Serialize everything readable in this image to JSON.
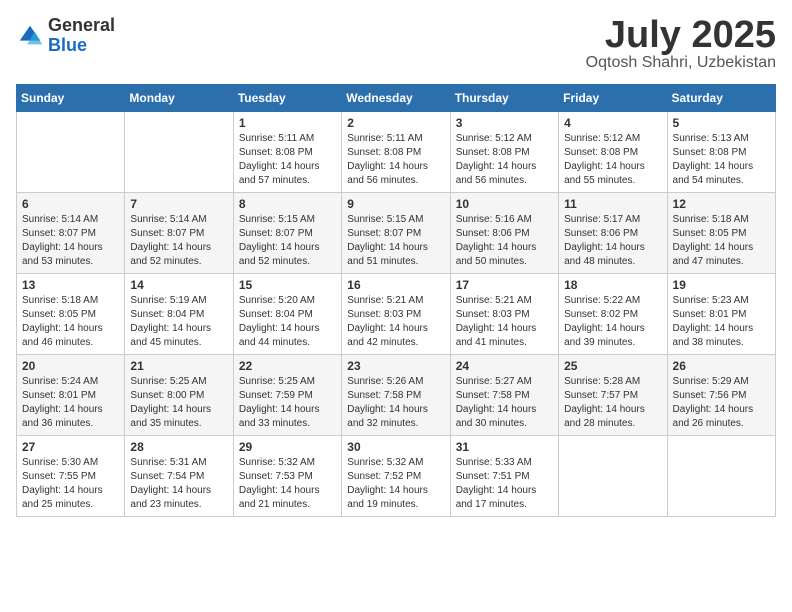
{
  "logo": {
    "general": "General",
    "blue": "Blue"
  },
  "title": "July 2025",
  "subtitle": "Oqtosh Shahri, Uzbekistan",
  "days_of_week": [
    "Sunday",
    "Monday",
    "Tuesday",
    "Wednesday",
    "Thursday",
    "Friday",
    "Saturday"
  ],
  "weeks": [
    [
      {
        "day": "",
        "content": ""
      },
      {
        "day": "",
        "content": ""
      },
      {
        "day": "1",
        "sunrise": "Sunrise: 5:11 AM",
        "sunset": "Sunset: 8:08 PM",
        "daylight": "Daylight: 14 hours and 57 minutes."
      },
      {
        "day": "2",
        "sunrise": "Sunrise: 5:11 AM",
        "sunset": "Sunset: 8:08 PM",
        "daylight": "Daylight: 14 hours and 56 minutes."
      },
      {
        "day": "3",
        "sunrise": "Sunrise: 5:12 AM",
        "sunset": "Sunset: 8:08 PM",
        "daylight": "Daylight: 14 hours and 56 minutes."
      },
      {
        "day": "4",
        "sunrise": "Sunrise: 5:12 AM",
        "sunset": "Sunset: 8:08 PM",
        "daylight": "Daylight: 14 hours and 55 minutes."
      },
      {
        "day": "5",
        "sunrise": "Sunrise: 5:13 AM",
        "sunset": "Sunset: 8:08 PM",
        "daylight": "Daylight: 14 hours and 54 minutes."
      }
    ],
    [
      {
        "day": "6",
        "sunrise": "Sunrise: 5:14 AM",
        "sunset": "Sunset: 8:07 PM",
        "daylight": "Daylight: 14 hours and 53 minutes."
      },
      {
        "day": "7",
        "sunrise": "Sunrise: 5:14 AM",
        "sunset": "Sunset: 8:07 PM",
        "daylight": "Daylight: 14 hours and 52 minutes."
      },
      {
        "day": "8",
        "sunrise": "Sunrise: 5:15 AM",
        "sunset": "Sunset: 8:07 PM",
        "daylight": "Daylight: 14 hours and 52 minutes."
      },
      {
        "day": "9",
        "sunrise": "Sunrise: 5:15 AM",
        "sunset": "Sunset: 8:07 PM",
        "daylight": "Daylight: 14 hours and 51 minutes."
      },
      {
        "day": "10",
        "sunrise": "Sunrise: 5:16 AM",
        "sunset": "Sunset: 8:06 PM",
        "daylight": "Daylight: 14 hours and 50 minutes."
      },
      {
        "day": "11",
        "sunrise": "Sunrise: 5:17 AM",
        "sunset": "Sunset: 8:06 PM",
        "daylight": "Daylight: 14 hours and 48 minutes."
      },
      {
        "day": "12",
        "sunrise": "Sunrise: 5:18 AM",
        "sunset": "Sunset: 8:05 PM",
        "daylight": "Daylight: 14 hours and 47 minutes."
      }
    ],
    [
      {
        "day": "13",
        "sunrise": "Sunrise: 5:18 AM",
        "sunset": "Sunset: 8:05 PM",
        "daylight": "Daylight: 14 hours and 46 minutes."
      },
      {
        "day": "14",
        "sunrise": "Sunrise: 5:19 AM",
        "sunset": "Sunset: 8:04 PM",
        "daylight": "Daylight: 14 hours and 45 minutes."
      },
      {
        "day": "15",
        "sunrise": "Sunrise: 5:20 AM",
        "sunset": "Sunset: 8:04 PM",
        "daylight": "Daylight: 14 hours and 44 minutes."
      },
      {
        "day": "16",
        "sunrise": "Sunrise: 5:21 AM",
        "sunset": "Sunset: 8:03 PM",
        "daylight": "Daylight: 14 hours and 42 minutes."
      },
      {
        "day": "17",
        "sunrise": "Sunrise: 5:21 AM",
        "sunset": "Sunset: 8:03 PM",
        "daylight": "Daylight: 14 hours and 41 minutes."
      },
      {
        "day": "18",
        "sunrise": "Sunrise: 5:22 AM",
        "sunset": "Sunset: 8:02 PM",
        "daylight": "Daylight: 14 hours and 39 minutes."
      },
      {
        "day": "19",
        "sunrise": "Sunrise: 5:23 AM",
        "sunset": "Sunset: 8:01 PM",
        "daylight": "Daylight: 14 hours and 38 minutes."
      }
    ],
    [
      {
        "day": "20",
        "sunrise": "Sunrise: 5:24 AM",
        "sunset": "Sunset: 8:01 PM",
        "daylight": "Daylight: 14 hours and 36 minutes."
      },
      {
        "day": "21",
        "sunrise": "Sunrise: 5:25 AM",
        "sunset": "Sunset: 8:00 PM",
        "daylight": "Daylight: 14 hours and 35 minutes."
      },
      {
        "day": "22",
        "sunrise": "Sunrise: 5:25 AM",
        "sunset": "Sunset: 7:59 PM",
        "daylight": "Daylight: 14 hours and 33 minutes."
      },
      {
        "day": "23",
        "sunrise": "Sunrise: 5:26 AM",
        "sunset": "Sunset: 7:58 PM",
        "daylight": "Daylight: 14 hours and 32 minutes."
      },
      {
        "day": "24",
        "sunrise": "Sunrise: 5:27 AM",
        "sunset": "Sunset: 7:58 PM",
        "daylight": "Daylight: 14 hours and 30 minutes."
      },
      {
        "day": "25",
        "sunrise": "Sunrise: 5:28 AM",
        "sunset": "Sunset: 7:57 PM",
        "daylight": "Daylight: 14 hours and 28 minutes."
      },
      {
        "day": "26",
        "sunrise": "Sunrise: 5:29 AM",
        "sunset": "Sunset: 7:56 PM",
        "daylight": "Daylight: 14 hours and 26 minutes."
      }
    ],
    [
      {
        "day": "27",
        "sunrise": "Sunrise: 5:30 AM",
        "sunset": "Sunset: 7:55 PM",
        "daylight": "Daylight: 14 hours and 25 minutes."
      },
      {
        "day": "28",
        "sunrise": "Sunrise: 5:31 AM",
        "sunset": "Sunset: 7:54 PM",
        "daylight": "Daylight: 14 hours and 23 minutes."
      },
      {
        "day": "29",
        "sunrise": "Sunrise: 5:32 AM",
        "sunset": "Sunset: 7:53 PM",
        "daylight": "Daylight: 14 hours and 21 minutes."
      },
      {
        "day": "30",
        "sunrise": "Sunrise: 5:32 AM",
        "sunset": "Sunset: 7:52 PM",
        "daylight": "Daylight: 14 hours and 19 minutes."
      },
      {
        "day": "31",
        "sunrise": "Sunrise: 5:33 AM",
        "sunset": "Sunset: 7:51 PM",
        "daylight": "Daylight: 14 hours and 17 minutes."
      },
      {
        "day": "",
        "content": ""
      },
      {
        "day": "",
        "content": ""
      }
    ]
  ]
}
